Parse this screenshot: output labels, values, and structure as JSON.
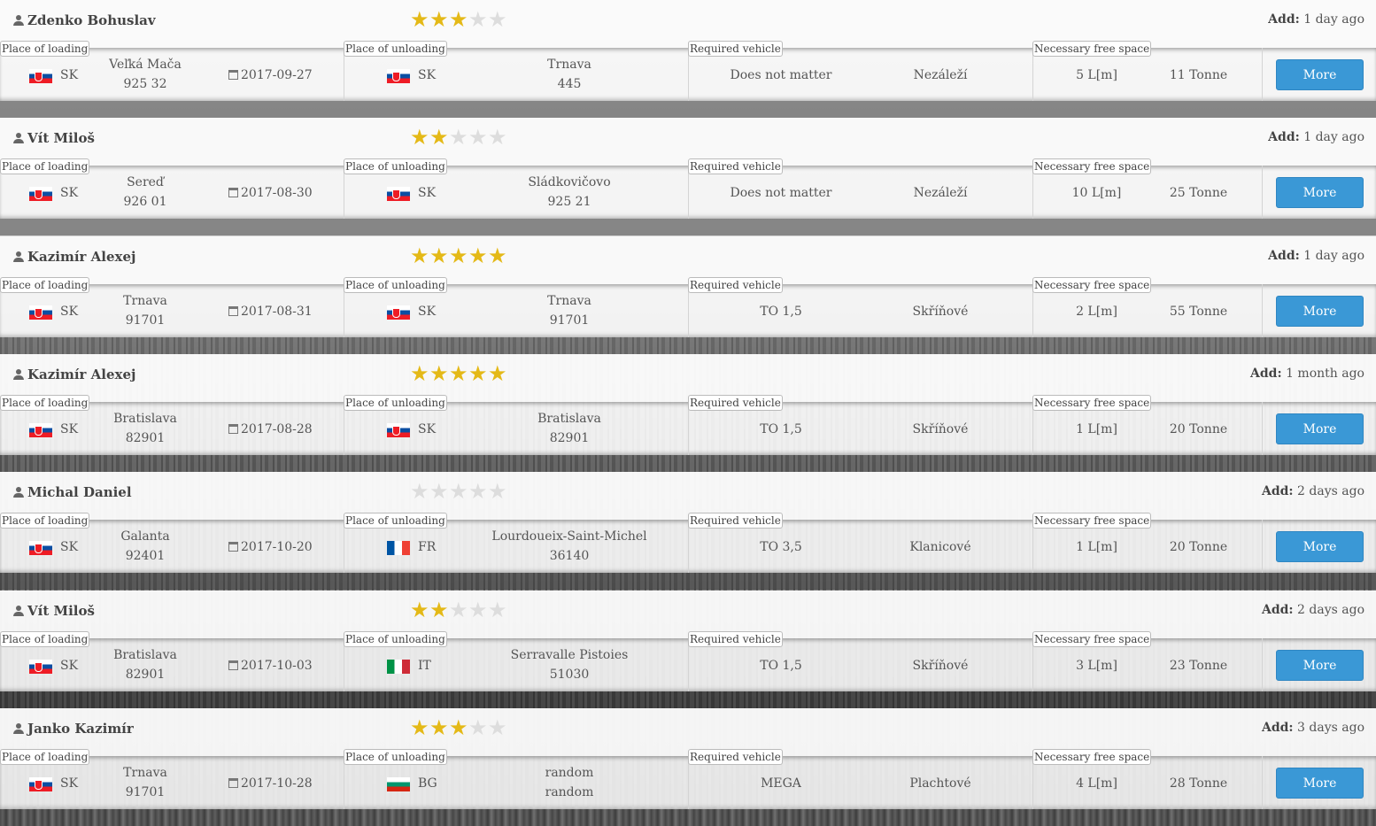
{
  "labels": {
    "place_of_loading": "Place of loading",
    "place_of_unloading": "Place of unloading",
    "required_vehicle": "Required vehicle",
    "necessary_free_space": "Necessary free space",
    "add_prefix": "Add:",
    "more_button": "More"
  },
  "colors": {
    "star_active": "#e4b917",
    "star_inactive": "#dddddd",
    "more_button": "#3a98d6"
  },
  "rows": [
    {
      "user": "Zdenko Bohuslav",
      "rating": 3,
      "added": "1 day ago",
      "loading": {
        "country": "SK",
        "flag": "sk",
        "city": "Veľká Mača",
        "zip": "925 32",
        "date": "2017-09-27"
      },
      "unloading": {
        "country": "SK",
        "flag": "sk",
        "city": "Trnava",
        "zip": "445"
      },
      "vehicle": "Does not matter",
      "vehicle_type": "Nezáleží",
      "space": "5 L[m]",
      "weight": "11 Tonne"
    },
    {
      "user": "Vít Miloš",
      "rating": 2,
      "added": "1 day ago",
      "loading": {
        "country": "SK",
        "flag": "sk",
        "city": "Sereď",
        "zip": "926 01",
        "date": "2017-08-30"
      },
      "unloading": {
        "country": "SK",
        "flag": "sk",
        "city": "Sládkovičovo",
        "zip": "925 21"
      },
      "vehicle": "Does not matter",
      "vehicle_type": "Nezáleží",
      "space": "10 L[m]",
      "weight": "25 Tonne"
    },
    {
      "user": "Kazimír Alexej",
      "rating": 5,
      "added": "1 day ago",
      "loading": {
        "country": "SK",
        "flag": "sk",
        "city": "Trnava",
        "zip": "91701",
        "date": "2017-08-31"
      },
      "unloading": {
        "country": "SK",
        "flag": "sk",
        "city": "Trnava",
        "zip": "91701"
      },
      "vehicle": "TO 1,5",
      "vehicle_type": "Skříňové",
      "space": "2 L[m]",
      "weight": "55 Tonne"
    },
    {
      "user": "Kazimír Alexej",
      "rating": 5,
      "added": "1 month ago",
      "loading": {
        "country": "SK",
        "flag": "sk",
        "city": "Bratislava",
        "zip": "82901",
        "date": "2017-08-28"
      },
      "unloading": {
        "country": "SK",
        "flag": "sk",
        "city": "Bratislava",
        "zip": "82901"
      },
      "vehicle": "TO 1,5",
      "vehicle_type": "Skříňové",
      "space": "1 L[m]",
      "weight": "20 Tonne"
    },
    {
      "user": "Michal Daniel",
      "rating": 0,
      "added": "2 days ago",
      "loading": {
        "country": "SK",
        "flag": "sk",
        "city": "Galanta",
        "zip": "92401",
        "date": "2017-10-20"
      },
      "unloading": {
        "country": "FR",
        "flag": "fr",
        "city": "Lourdoueix-Saint-Michel",
        "zip": "36140"
      },
      "vehicle": "TO 3,5",
      "vehicle_type": "Klanicové",
      "space": "1 L[m]",
      "weight": "20 Tonne"
    },
    {
      "user": "Vít Miloš",
      "rating": 2,
      "added": "2 days ago",
      "loading": {
        "country": "SK",
        "flag": "sk",
        "city": "Bratislava",
        "zip": "82901",
        "date": "2017-10-03"
      },
      "unloading": {
        "country": "IT",
        "flag": "it",
        "city": "Serravalle Pistoies",
        "zip": "51030"
      },
      "vehicle": "TO 1,5",
      "vehicle_type": "Skříňové",
      "space": "3 L[m]",
      "weight": "23 Tonne"
    },
    {
      "user": "Janko Kazimír",
      "rating": 3,
      "added": "3 days ago",
      "loading": {
        "country": "SK",
        "flag": "sk",
        "city": "Trnava",
        "zip": "91701",
        "date": "2017-10-28"
      },
      "unloading": {
        "country": "BG",
        "flag": "bg",
        "city": "random",
        "zip": "random"
      },
      "vehicle": "MEGA",
      "vehicle_type": "Plachtové",
      "space": "4 L[m]",
      "weight": "28 Tonne"
    }
  ]
}
